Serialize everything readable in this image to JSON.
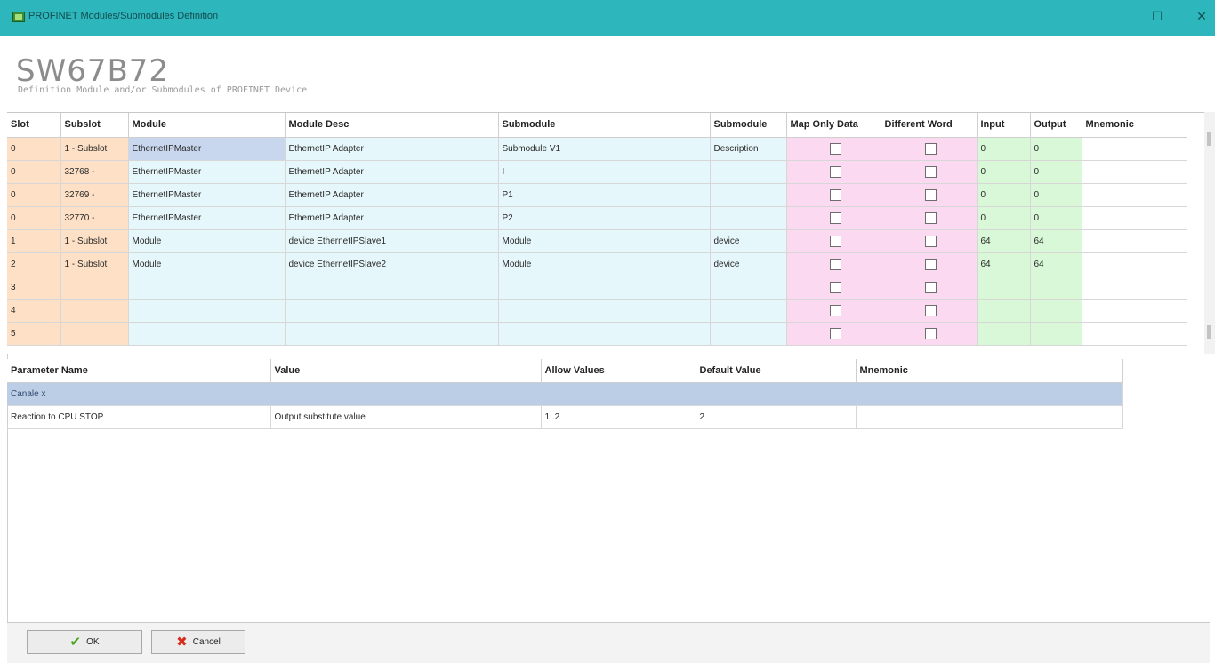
{
  "window": {
    "title": "PROFINET Modules/Submodules Definition",
    "maximize_glyph": "☐",
    "close_glyph": "✕"
  },
  "header": {
    "product": "SW67B72",
    "subtitle": "Definition Module and/or Submodules of PROFINET Device"
  },
  "grid": {
    "columns": [
      "Slot",
      "Subslot",
      "Module",
      "Module Desc",
      "Submodule",
      "Submodule",
      "Map Only Data",
      "Different Word",
      "Input",
      "Output",
      "Mnemonic"
    ],
    "rows": [
      {
        "slot": "0",
        "subslot": "1 - Subslot",
        "module": "EthernetIPMaster",
        "module_desc": "EthernetIP Adapter",
        "submodule": "Submodule V1",
        "submodule_desc": "Description",
        "input": "0",
        "output": "0",
        "mnemonic": ""
      },
      {
        "slot": "0",
        "subslot": "32768 -",
        "module": "EthernetIPMaster",
        "module_desc": "EthernetIP Adapter",
        "submodule": "I",
        "submodule_desc": "",
        "input": "0",
        "output": "0",
        "mnemonic": ""
      },
      {
        "slot": "0",
        "subslot": "32769 -",
        "module": "EthernetIPMaster",
        "module_desc": "EthernetIP Adapter",
        "submodule": "P1",
        "submodule_desc": "",
        "input": "0",
        "output": "0",
        "mnemonic": ""
      },
      {
        "slot": "0",
        "subslot": "32770 -",
        "module": "EthernetIPMaster",
        "module_desc": "EthernetIP Adapter",
        "submodule": "P2",
        "submodule_desc": "",
        "input": "0",
        "output": "0",
        "mnemonic": ""
      },
      {
        "slot": "1",
        "subslot": "1 - Subslot",
        "module": "Module",
        "module_desc": "device EthernetIPSlave1",
        "submodule": "Module",
        "submodule_desc": "device",
        "input": "64",
        "output": "64",
        "mnemonic": ""
      },
      {
        "slot": "2",
        "subslot": "1 - Subslot",
        "module": "Module",
        "module_desc": "device EthernetIPSlave2",
        "submodule": "Module",
        "submodule_desc": "device",
        "input": "64",
        "output": "64",
        "mnemonic": ""
      },
      {
        "slot": "3",
        "subslot": "",
        "module": "",
        "module_desc": "",
        "submodule": "",
        "submodule_desc": "",
        "input": "",
        "output": "",
        "mnemonic": ""
      },
      {
        "slot": "4",
        "subslot": "",
        "module": "",
        "module_desc": "",
        "submodule": "",
        "submodule_desc": "",
        "input": "",
        "output": "",
        "mnemonic": ""
      },
      {
        "slot": "5",
        "subslot": "",
        "module": "",
        "module_desc": "",
        "submodule": "",
        "submodule_desc": "",
        "input": "",
        "output": "",
        "mnemonic": ""
      }
    ]
  },
  "params": {
    "columns": [
      "Parameter Name",
      "Value",
      "Allow Values",
      "Default Value",
      "Mnemonic"
    ],
    "group": "Canale x",
    "rows": [
      {
        "name": "Reaction to CPU STOP",
        "value": "Output substitute value",
        "allow": "1..2",
        "default": "2",
        "mnemonic": ""
      }
    ]
  },
  "footer": {
    "ok_label": "OK",
    "cancel_label": "Cancel"
  },
  "colors": {
    "titlebar": "#2db6bb",
    "slot_columns": "#fde0c5",
    "description_columns": "#e6f7fb",
    "checkbox_columns": "#fbd9f0",
    "io_columns": "#d8f8d8",
    "selected_cell": "#c9d7ee",
    "group_row": "#bccde6"
  }
}
